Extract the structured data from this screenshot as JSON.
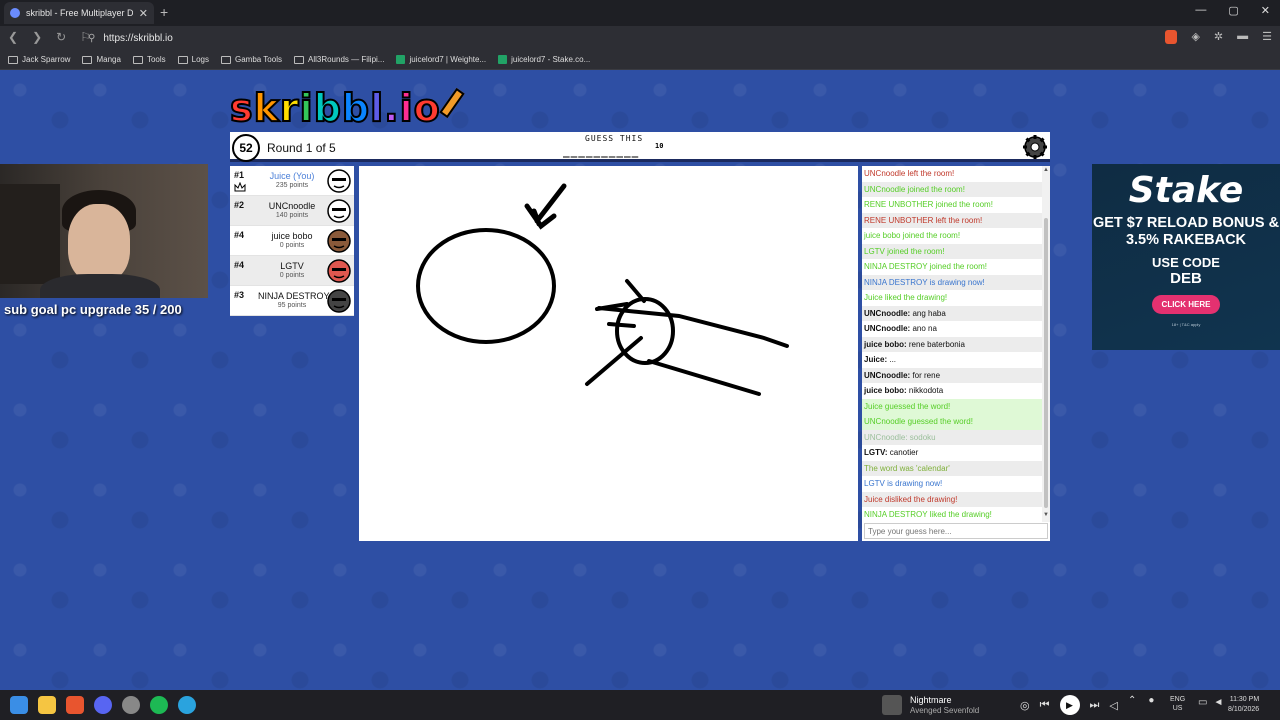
{
  "browser": {
    "tab_title": "skribbl - Free Multiplayer Drawin",
    "url": "https://skribbl.io",
    "bookmarks": [
      "Jack Sparrow",
      "Manga",
      "Tools",
      "Logs",
      "Gamba Tools",
      "All3Rounds — Filipi...",
      "juicelord7 | Weighte...",
      "juicelord7 - Stake.co..."
    ]
  },
  "game": {
    "logo": {
      "letters": [
        "s",
        "k",
        "r",
        "i",
        "b",
        "b",
        "l",
        ".",
        "i",
        "o"
      ],
      "colors": [
        "#ff3b30",
        "#ff9500",
        "#ffdd00",
        "#34c759",
        "#00c7be",
        "#0a84ff",
        "#5e5ce6",
        "#bf5af2",
        "#ff2d92",
        "#ff3b30"
      ]
    },
    "timer": "52",
    "round_text": "Round 1 of 5",
    "guess_label": "GUESS THIS",
    "word_blanks": "__________",
    "word_length": "10",
    "players": [
      {
        "rank": "#1",
        "name": "Juice (You)",
        "points": "235 points",
        "is_you": true,
        "crown": true,
        "avatar": "white"
      },
      {
        "rank": "#2",
        "name": "UNCnoodle",
        "points": "140 points",
        "is_you": false,
        "crown": false,
        "avatar": "white"
      },
      {
        "rank": "#4",
        "name": "juice bobo",
        "points": "0 points",
        "is_you": false,
        "crown": false,
        "avatar": "brown"
      },
      {
        "rank": "#4",
        "name": "LGTV",
        "points": "0 points",
        "is_you": false,
        "crown": false,
        "avatar": "red"
      },
      {
        "rank": "#3",
        "name": "NINJA DESTROY",
        "points": "95 points",
        "is_you": false,
        "crown": false,
        "avatar": "gray"
      }
    ],
    "chat": [
      {
        "type": "left",
        "text": "UNCnoodle left the room!"
      },
      {
        "type": "join",
        "text": "UNCnoodle joined the room!"
      },
      {
        "type": "join",
        "text": "RENE UNBOTHER joined the room!"
      },
      {
        "type": "left",
        "text": "RENE UNBOTHER left the room!"
      },
      {
        "type": "join",
        "text": "juice bobo joined the room!"
      },
      {
        "type": "join",
        "text": "LGTV joined the room!"
      },
      {
        "type": "join",
        "text": "NINJA DESTROY joined the room!"
      },
      {
        "type": "draw",
        "text": "NINJA DESTROY is drawing now!"
      },
      {
        "type": "liked",
        "text": "Juice liked the drawing!"
      },
      {
        "type": "plain",
        "user": "UNCnoodle:",
        "text": " ang haba"
      },
      {
        "type": "plain",
        "user": "UNCnoodle:",
        "text": " ano na"
      },
      {
        "type": "plain",
        "user": "juice bobo:",
        "text": " rene baterbonia"
      },
      {
        "type": "plain",
        "user": "Juice:",
        "text": " ..."
      },
      {
        "type": "plain",
        "user": "UNCnoodle:",
        "text": " for rene"
      },
      {
        "type": "plain",
        "user": "juice bobo:",
        "text": " nikkodota"
      },
      {
        "type": "correct",
        "text": "Juice guessed the word!"
      },
      {
        "type": "correct",
        "text": "UNCnoodle guessed the word!"
      },
      {
        "type": "faded",
        "text": "UNCnoodle: sodoku"
      },
      {
        "type": "plain",
        "user": "LGTV:",
        "text": " canotier"
      },
      {
        "type": "word",
        "text": "The word was 'calendar'"
      },
      {
        "type": "draw",
        "text": "LGTV is drawing now!"
      },
      {
        "type": "disliked",
        "text": "Juice disliked the drawing!"
      },
      {
        "type": "liked",
        "text": "NINJA DESTROY liked the drawing!"
      }
    ],
    "input_placeholder": "Type your guess here..."
  },
  "overlay": {
    "sub_goal": "sub goal pc upgrade 35 / 200"
  },
  "ad": {
    "brand": "Stake",
    "line1": "GET $7 RELOAD BONUS & 3.5% RAKEBACK",
    "line2": "USE CODE",
    "code": "DEB",
    "button": "CLICK HERE",
    "fine_print": "18+ | T&C apply"
  },
  "taskbar": {
    "song": "Nightmare",
    "artist": "Avenged Sevenfold",
    "lang_top": "ENG",
    "lang_bottom": "US",
    "time": "11:30 PM",
    "date": "8/10/2026"
  }
}
